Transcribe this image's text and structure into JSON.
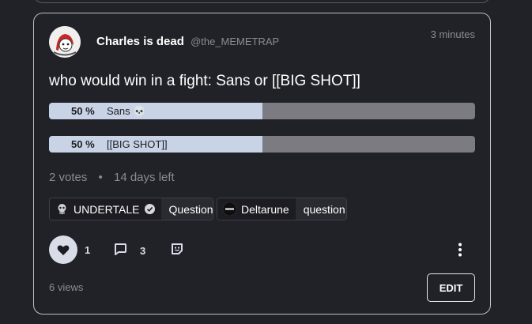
{
  "post": {
    "author_name": "Charles is dead",
    "author_handle": "@the_MEMETRAP",
    "time_ago": "3 minutes",
    "question": "who would win in a fight: Sans or [[BIG SHOT]]"
  },
  "poll": {
    "options": [
      {
        "percent_label": "50 %",
        "label": "Sans 💀",
        "fraction": 0.5
      },
      {
        "percent_label": "50 %",
        "label": "[[BIG SHOT]]",
        "fraction": 0.5
      }
    ],
    "votes": "2 votes",
    "separator": "•",
    "remaining": "14 days left"
  },
  "tags": [
    {
      "community": "UNDERTALE",
      "flair": "Question",
      "icon": "skull-icon",
      "verified": true
    },
    {
      "community": "Deltarune",
      "flair": "question",
      "icon": "deltarune-logo-icon",
      "verified": false
    }
  ],
  "actions": {
    "like_count": "1",
    "comment_count": "3",
    "icons": {
      "like": "heart-icon",
      "comment": "comment-icon",
      "share": "sticker-icon",
      "more": "more-vertical-icon"
    }
  },
  "footer": {
    "views": "6 views",
    "edit_label": "EDIT"
  },
  "colors": {
    "background": "#212128",
    "poll_fill": "#c9d3e6",
    "poll_track": "#7c7b82",
    "muted_text": "#8b8b93"
  }
}
